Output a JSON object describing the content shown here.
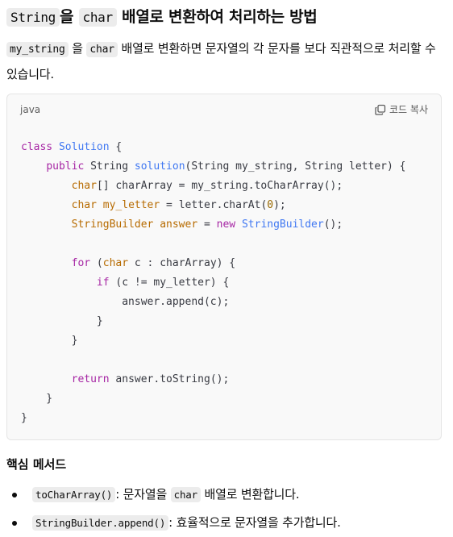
{
  "heading": {
    "code1": "String",
    "text1": "을 ",
    "code2": "char",
    "text2": " 배열로 변환하여 처리하는 방법"
  },
  "intro": {
    "code1": "my_string",
    "text1": " 을 ",
    "code2": "char",
    "text2": " 배열로 변환하면 문자열의 각 문자를 보다 직관적으로 처리할 수 있습니다."
  },
  "code_block": {
    "language": "java",
    "copy_label": "코드 복사",
    "copy_icon": "copy-icon"
  },
  "section_title": "핵심 메서드",
  "methods": [
    {
      "code": "toCharArray()",
      "desc": ": 문자열을 ",
      "code2": "char",
      "desc2": " 배열로 변환합니다."
    },
    {
      "code": "StringBuilder.append()",
      "desc": ": 효율적으로 문자열을 추가합니다."
    }
  ],
  "colors": {
    "keyword": "#a626a4",
    "type": "#b76b01",
    "function": "#4078f2",
    "number": "#986801"
  }
}
